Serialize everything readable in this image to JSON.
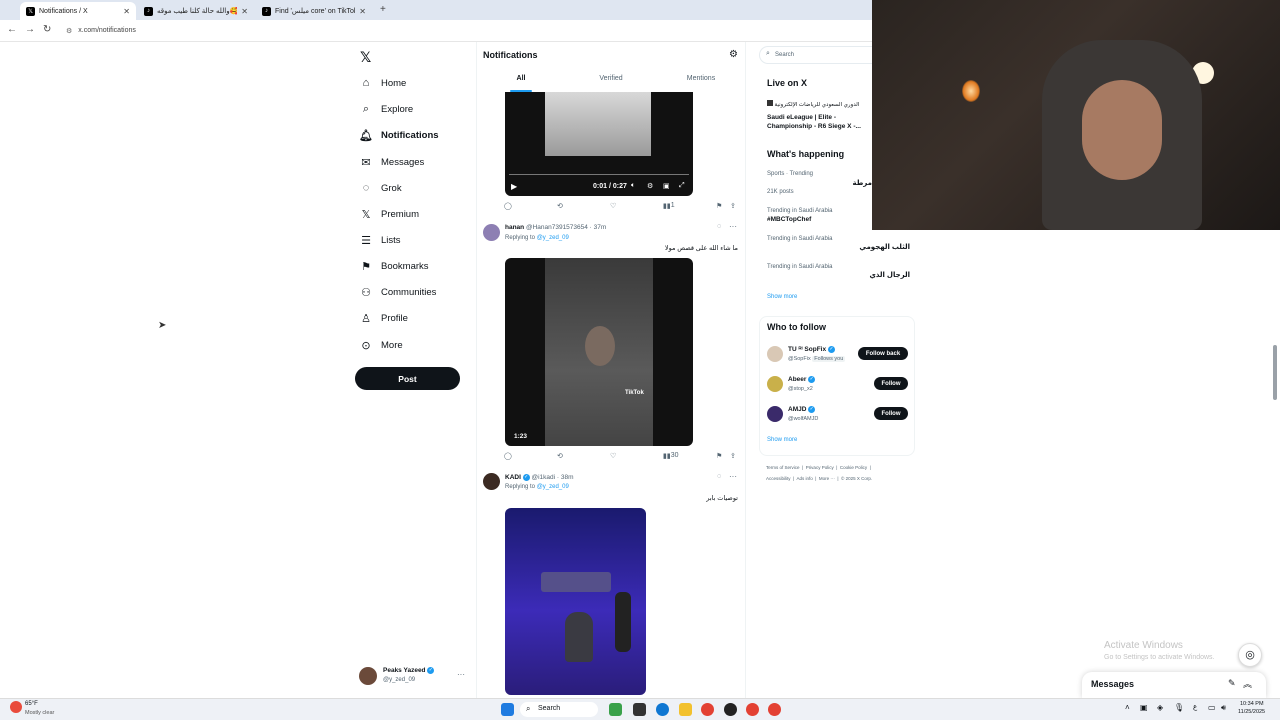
{
  "browser": {
    "tabs": [
      {
        "title": "Notifications / X",
        "icon": "x-logo-icon"
      },
      {
        "title": "والله حالة كلنا طيب موقه🥰💗",
        "icon": "tiktok-icon"
      },
      {
        "title": "Find 'ميلس core' on TikTok | Ti",
        "icon": "tiktok-icon"
      }
    ],
    "new_tab": "+",
    "url": "x.com/notifications"
  },
  "nav": {
    "items": [
      {
        "label": "Home",
        "icon": "home-icon"
      },
      {
        "label": "Explore",
        "icon": "search-icon"
      },
      {
        "label": "Notifications",
        "icon": "bell-icon"
      },
      {
        "label": "Messages",
        "icon": "envelope-icon"
      },
      {
        "label": "Grok",
        "icon": "grok-icon"
      },
      {
        "label": "Premium",
        "icon": "x-logo-icon"
      },
      {
        "label": "Lists",
        "icon": "list-icon"
      },
      {
        "label": "Bookmarks",
        "icon": "bookmark-icon"
      },
      {
        "label": "Communities",
        "icon": "people-icon"
      },
      {
        "label": "Profile",
        "icon": "person-icon"
      },
      {
        "label": "More",
        "icon": "more-circle-icon"
      }
    ],
    "post_label": "Post",
    "account": {
      "name": "Peaks Yazeed",
      "handle": "@y_zed_09"
    }
  },
  "notifications": {
    "title": "Notifications",
    "tabs": [
      "All",
      "Verified",
      "Mentions"
    ],
    "video1": {
      "time": "0:01 / 0:27"
    },
    "post1_actions": {
      "views": "1"
    },
    "reply1": {
      "name": "hanan",
      "handle": "@Hanan7391573654 · 37m",
      "replying": "Replying to",
      "replying_handle": "@y_zed_09",
      "text": "ما شاء الله على قصص مولا",
      "video_duration": "1:23",
      "views": "30",
      "video_caption": "TikTok"
    },
    "reply2": {
      "name": "KADI",
      "handle": "@i1kadi · 38m",
      "replying": "Replying to",
      "replying_handle": "@y_zed_09",
      "text": "توصيات بابر"
    }
  },
  "right": {
    "search_placeholder": "Search",
    "live_title": "Live on X",
    "live_host": "الدوري السعودي للرياضات الإلكترونية",
    "live_text": "Saudi eLeague | Elite - Championship - R6 Siege X -...",
    "happening_title": "What's happening",
    "trends": [
      {
        "context": "Sports · Trending",
        "name": "مرطة",
        "posts": "21K posts"
      },
      {
        "context": "Trending in Saudi Arabia",
        "name": "#MBCTopChef",
        "posts": ""
      },
      {
        "context": "Trending in Saudi Arabia",
        "name": "الثلب الهجومي",
        "posts": ""
      },
      {
        "context": "Trending in Saudi Arabia",
        "name": "الرجال الذي",
        "posts": ""
      }
    ],
    "show_more": "Show more",
    "follow_title": "Who to follow",
    "follow": [
      {
        "name": "TU ᴿᴵ SopFix",
        "handle": "@SopFix",
        "badge": "Follows you",
        "button": "Follow back"
      },
      {
        "name": "Abeer",
        "handle": "@stop_x2",
        "badge": "",
        "button": "Follow"
      },
      {
        "name": "AMJD",
        "handle": "@wolfAMJD",
        "badge": "",
        "button": "Follow"
      }
    ],
    "show_more2": "Show more",
    "footer": [
      "Terms of Service",
      "Privacy Policy",
      "Cookie Policy",
      "Accessibility",
      "Ads info",
      "More ···",
      "© 2025 X Corp."
    ]
  },
  "activate": {
    "line1": "Activate Windows",
    "line2": "Go to Settings to activate Windows."
  },
  "messages_drawer": {
    "label": "Messages"
  },
  "taskbar": {
    "weather_temp": "65°F",
    "weather_desc": "Mostly clear",
    "search_label": "Search",
    "time": "10:34 PM",
    "date": "11/25/2025",
    "lang": "ع"
  }
}
